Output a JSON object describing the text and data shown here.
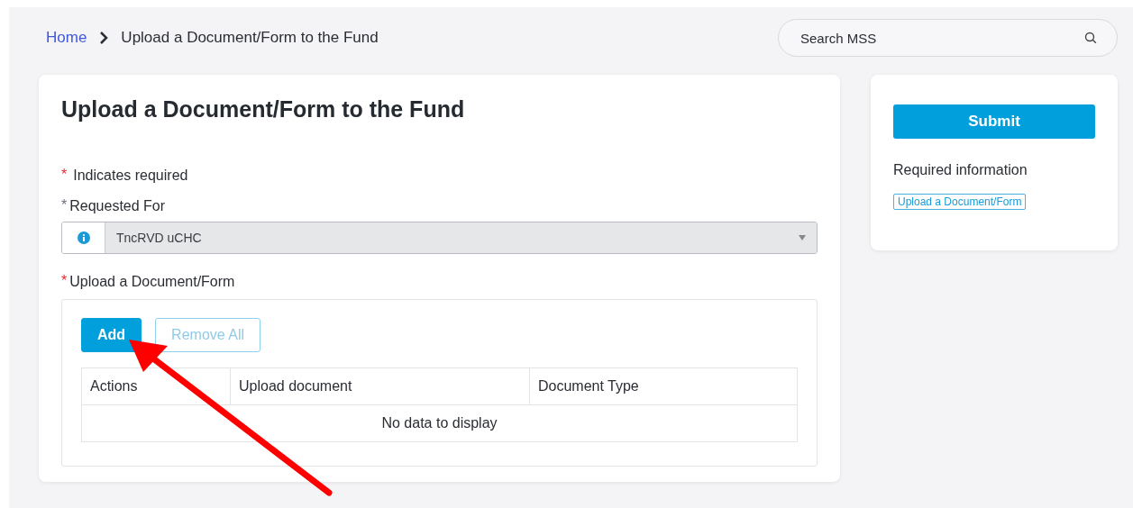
{
  "breadcrumb": {
    "items": [
      {
        "label": "Home",
        "kind": "link"
      },
      {
        "label": "Upload a Document/Form to the Fund",
        "kind": "current"
      }
    ]
  },
  "search": {
    "placeholder": "Search MSS"
  },
  "form": {
    "title": "Upload a Document/Form to the Fund",
    "required_note": {
      "mark": "*",
      "text": "Indicates required"
    },
    "requested_for": {
      "mark": "*",
      "label": "Requested For",
      "satisfied": true,
      "value": "TncRVD uCHC",
      "disabled": true
    },
    "upload": {
      "mark": "*",
      "label": "Upload a Document/Form",
      "satisfied": false,
      "buttons": [
        {
          "label": "Add",
          "kind": "primary",
          "disabled": false
        },
        {
          "label": "Remove All",
          "kind": "outline",
          "disabled": true
        }
      ],
      "table": {
        "columns": [
          "Actions",
          "Upload document",
          "Document Type"
        ],
        "empty_text": "No data to display"
      }
    }
  },
  "side": {
    "submit": "Submit",
    "required_title": "Required information",
    "required_links": [
      "Upload a Document/Form"
    ]
  },
  "annotation": {
    "kind": "arrow"
  }
}
